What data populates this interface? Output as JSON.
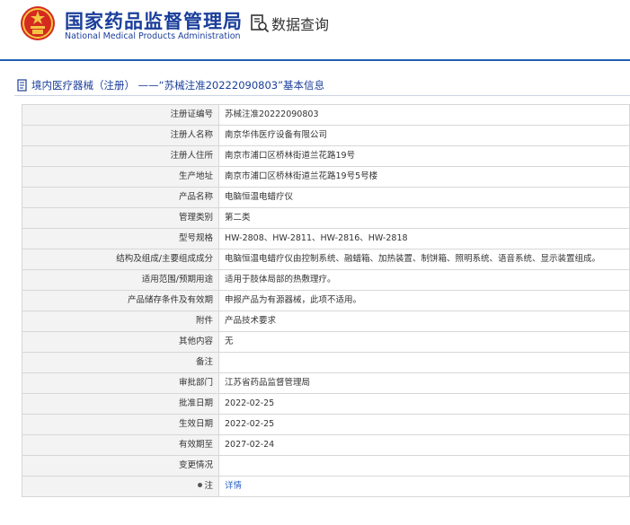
{
  "header": {
    "site_title": "国家药品监督管理局",
    "site_subtitle": "National Medical Products Administration",
    "query_label": "数据查询"
  },
  "panel": {
    "title": "境内医疗器械（注册） ——“苏械注准20222090803”基本信息"
  },
  "rows": [
    {
      "label": "注册证编号",
      "value": "苏械注准20222090803"
    },
    {
      "label": "注册人名称",
      "value": "南京华伟医疗设备有限公司"
    },
    {
      "label": "注册人住所",
      "value": "南京市浦口区桥林街道兰花路19号"
    },
    {
      "label": "生产地址",
      "value": "南京市浦口区桥林街道兰花路19号5号楼"
    },
    {
      "label": "产品名称",
      "value": "电脑恒温电蜡疗仪"
    },
    {
      "label": "管理类别",
      "value": "第二类"
    },
    {
      "label": "型号规格",
      "value": "HW-2808、HW-2811、HW-2816、HW-2818"
    },
    {
      "label": "结构及组成/主要组成成分",
      "value": "电脑恒温电蜡疗仪由控制系统、融蜡箱、加热装置、制饼箱、照明系统、语音系统、显示装置组成。"
    },
    {
      "label": "适用范围/预期用途",
      "value": "适用于肢体局部的热敷理疗。"
    },
    {
      "label": "产品储存条件及有效期",
      "value": "申报产品为有源器械，此项不适用。"
    },
    {
      "label": "附件",
      "value": "产品技术要求"
    },
    {
      "label": "其他内容",
      "value": "无"
    },
    {
      "label": "备注",
      "value": ""
    },
    {
      "label": "审批部门",
      "value": "江苏省药品监督管理局"
    },
    {
      "label": "批准日期",
      "value": "2022-02-25"
    },
    {
      "label": "生效日期",
      "value": "2022-02-25"
    },
    {
      "label": "有效期至",
      "value": "2027-02-24"
    },
    {
      "label": "变更情况",
      "value": ""
    },
    {
      "label": "注",
      "value": "详情"
    }
  ],
  "colors": {
    "brand_blue": "#1a3e9a",
    "rule_blue": "#1f5fb0",
    "link_blue": "#2a62c9",
    "label_bg": "#f3f3f3",
    "border": "#d7d7d7"
  },
  "icons": {
    "logo": "national-emblem-icon",
    "query": "data-query-icon",
    "panel": "document-icon",
    "note": "dot-icon"
  }
}
